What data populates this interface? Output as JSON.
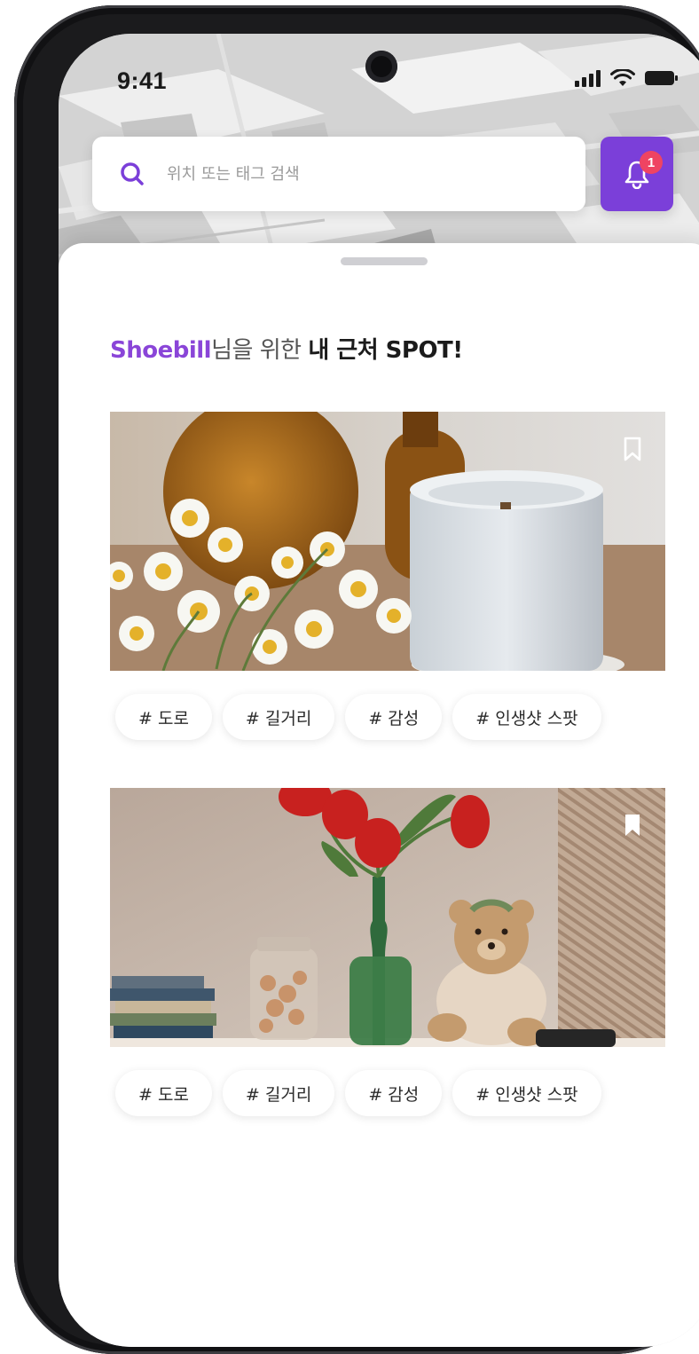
{
  "status_bar": {
    "time": "9:41"
  },
  "search": {
    "placeholder": "위치 또는 태그 검색"
  },
  "notifications": {
    "count": "1"
  },
  "sheet": {
    "heading_user": "Shoebill",
    "heading_suffix": "님을 위한 ",
    "heading_bold": "내 근처 SPOT!"
  },
  "spots": [
    {
      "bookmarked": false,
      "tags": [
        "# 도로",
        "# 길거리",
        "# 감성",
        "# 인생샷 스팟"
      ]
    },
    {
      "bookmarked": true,
      "tags": [
        "# 도로",
        "# 길거리",
        "# 감성",
        "# 인생샷 스팟"
      ]
    }
  ],
  "colors": {
    "accent": "#7b3fd9",
    "username": "#8a45d8",
    "badge": "#ef4462"
  }
}
